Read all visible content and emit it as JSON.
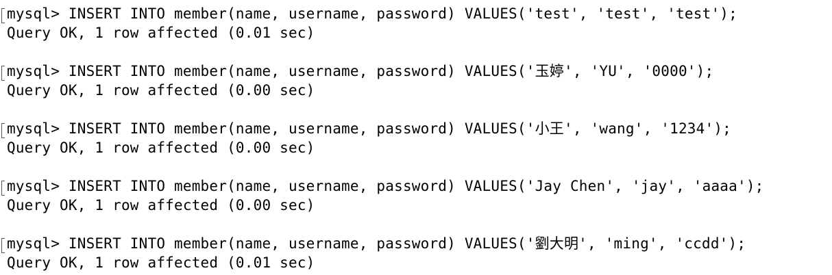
{
  "entries": [
    {
      "command": "mysql> INSERT INTO member(name, username, password) VALUES('test', 'test', 'test');",
      "result": "Query OK, 1 row affected (0.01 sec)"
    },
    {
      "command": "mysql> INSERT INTO member(name, username, password) VALUES('玉婷', 'YU', '0000');",
      "result": "Query OK, 1 row affected (0.00 sec)"
    },
    {
      "command": "mysql> INSERT INTO member(name, username, password) VALUES('小王', 'wang', '1234');",
      "result": "Query OK, 1 row affected (0.00 sec)"
    },
    {
      "command": "mysql> INSERT INTO member(name, username, password) VALUES('Jay Chen', 'jay', 'aaaa');",
      "result": "Query OK, 1 row affected (0.00 sec)"
    },
    {
      "command": "mysql> INSERT INTO member(name, username, password) VALUES('劉大明', 'ming', 'ccdd');",
      "result": "Query OK, 1 row affected (0.01 sec)"
    }
  ]
}
